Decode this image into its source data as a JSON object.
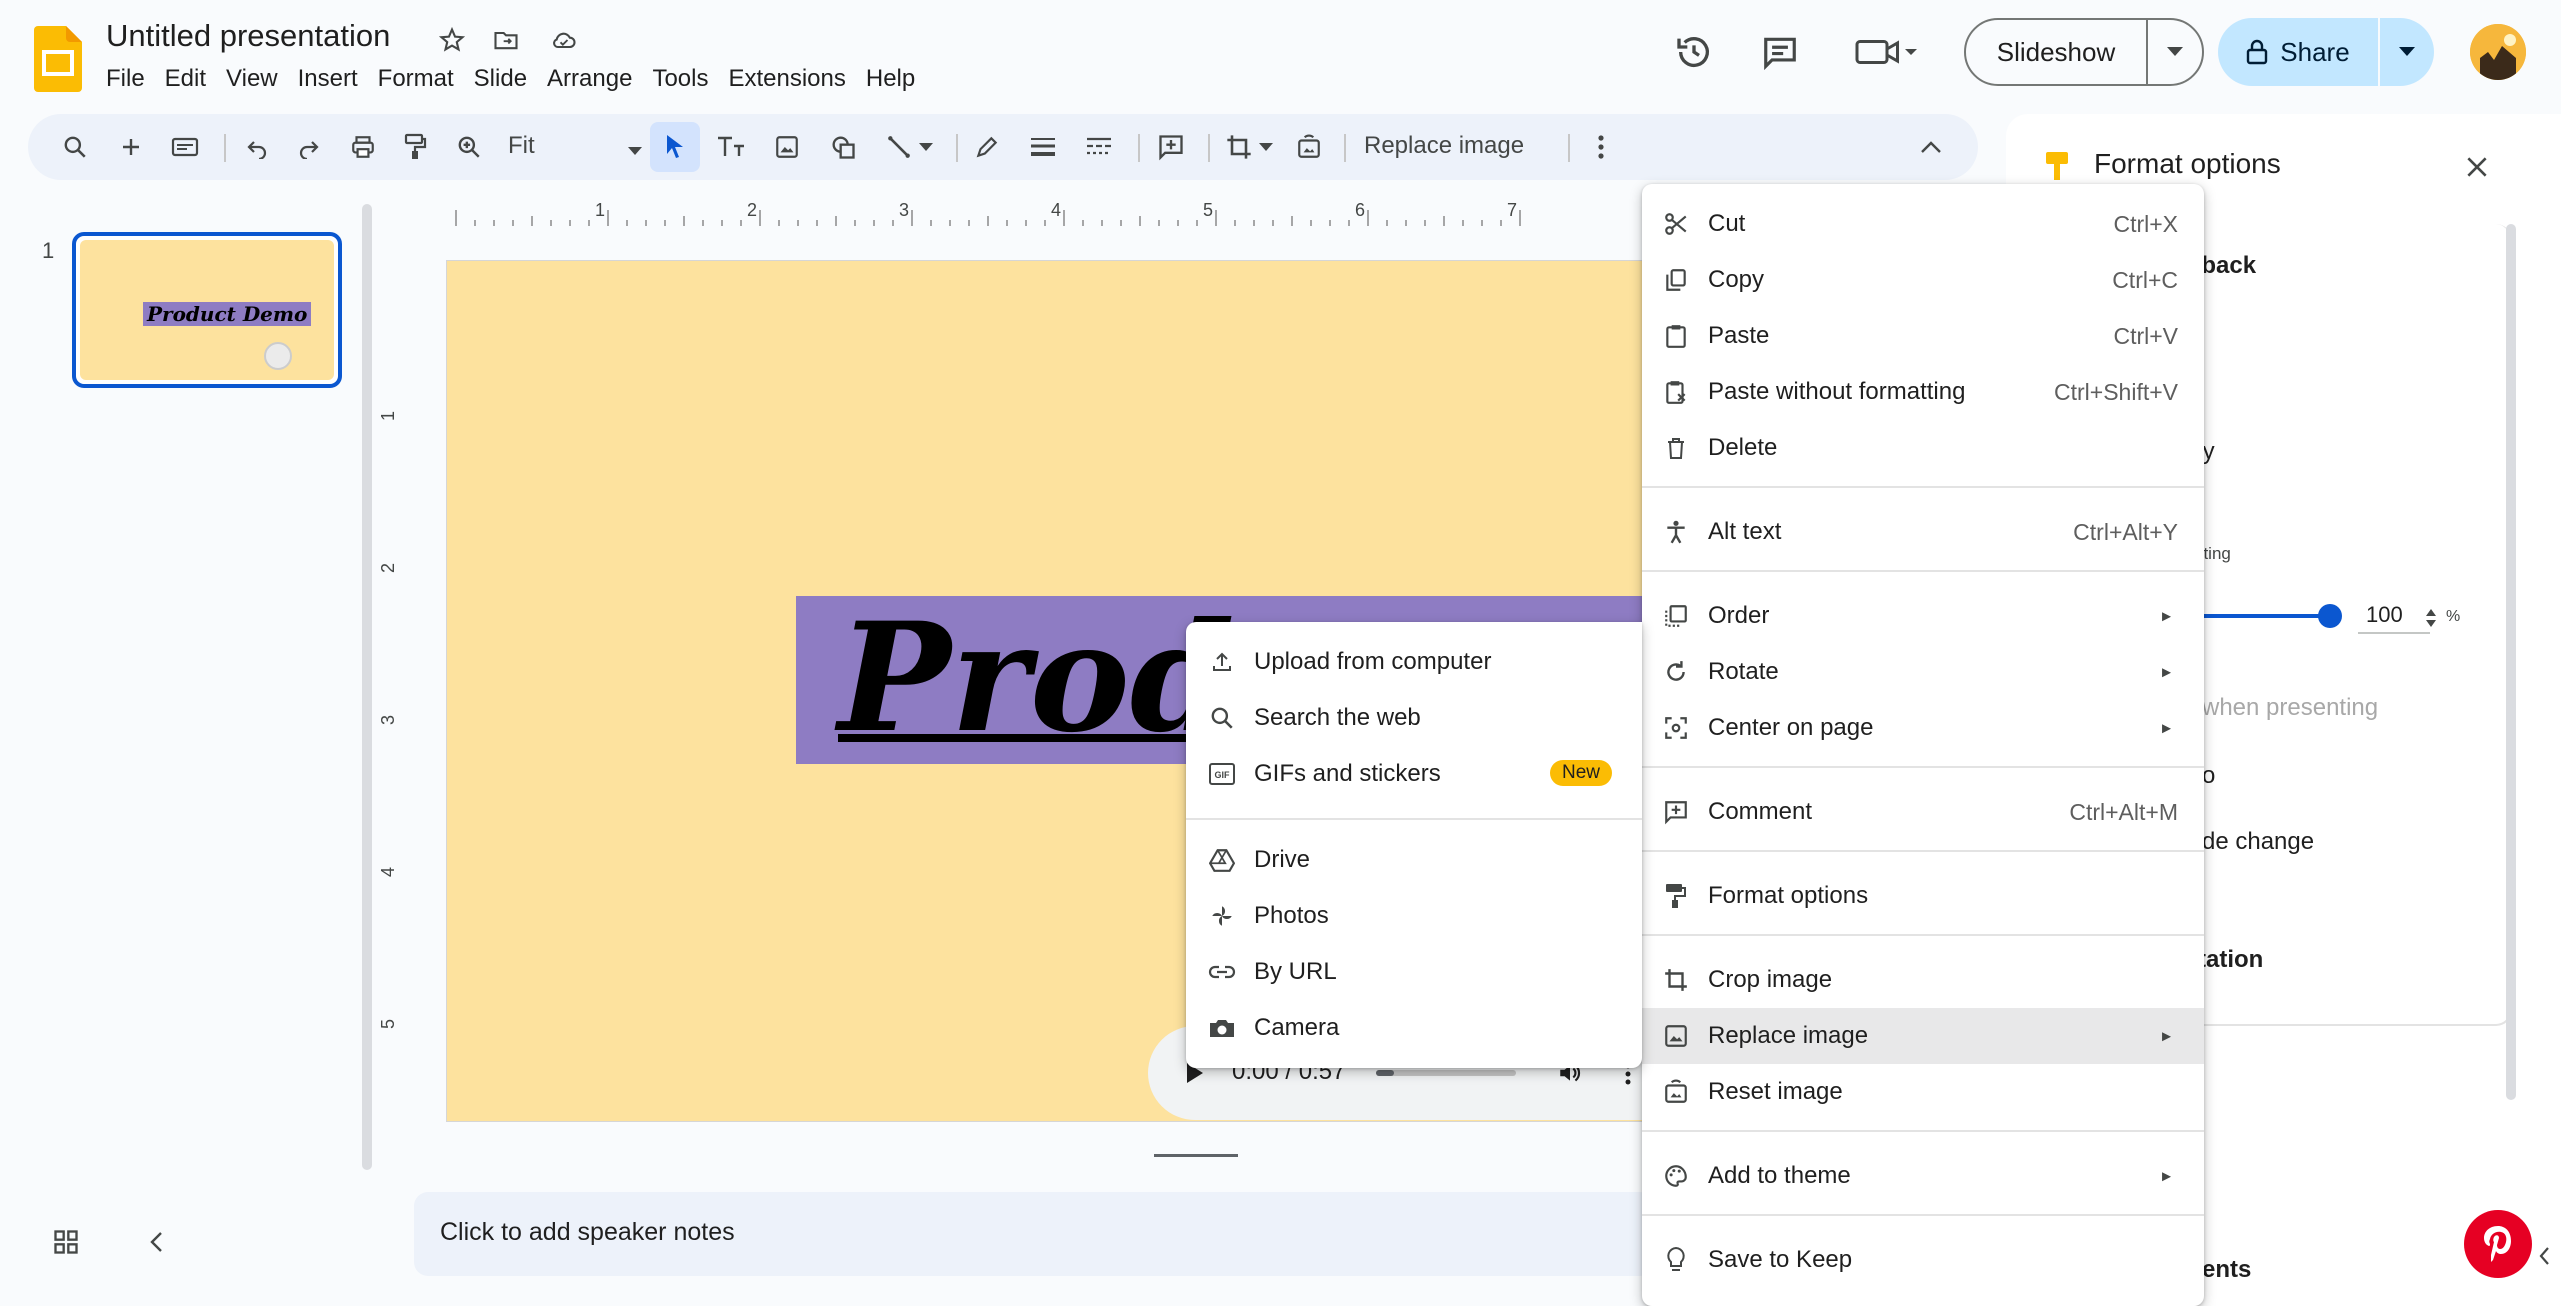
{
  "app": {
    "doc_title": "Untitled presentation",
    "menus": [
      "File",
      "Edit",
      "View",
      "Insert",
      "Format",
      "Slide",
      "Arrange",
      "Tools",
      "Extensions",
      "Help"
    ]
  },
  "header": {
    "slideshow_label": "Slideshow",
    "share_label": "Share"
  },
  "toolbar": {
    "zoom_value": "Fit",
    "replace_image_label": "Replace image"
  },
  "filmstrip": {
    "slide_number": "1",
    "thumb_title": "Product Demo"
  },
  "rulers": {
    "top": [
      "1",
      "2",
      "3",
      "4",
      "5",
      "6",
      "7"
    ],
    "left": [
      "1",
      "2",
      "3",
      "4",
      "5"
    ]
  },
  "slide": {
    "title_visible": "Produ",
    "audio_time": "0:00 / 0:57"
  },
  "notes": {
    "placeholder": "Click to add speaker notes"
  },
  "side_panel": {
    "title": "Format options",
    "fragments": [
      "yback",
      "lly",
      "nting",
      "when presenting",
      "o",
      "de change",
      "tation",
      "ents"
    ],
    "volume_value": "100",
    "volume_unit": "%"
  },
  "context_menu": {
    "groups": [
      [
        {
          "label": "Cut",
          "shortcut": "Ctrl+X",
          "icon": "scissors-icon"
        },
        {
          "label": "Copy",
          "shortcut": "Ctrl+C",
          "icon": "copy-icon"
        },
        {
          "label": "Paste",
          "shortcut": "Ctrl+V",
          "icon": "paste-icon"
        },
        {
          "label": "Paste without formatting",
          "shortcut": "Ctrl+Shift+V",
          "icon": "paste-plain-icon"
        },
        {
          "label": "Delete",
          "shortcut": "",
          "icon": "trash-icon"
        }
      ],
      [
        {
          "label": "Alt text",
          "shortcut": "Ctrl+Alt+Y",
          "icon": "accessibility-icon"
        }
      ],
      [
        {
          "label": "Order",
          "submenu": true,
          "icon": "order-icon"
        },
        {
          "label": "Rotate",
          "submenu": true,
          "icon": "rotate-icon"
        },
        {
          "label": "Center on page",
          "submenu": true,
          "icon": "center-icon"
        }
      ],
      [
        {
          "label": "Comment",
          "shortcut": "Ctrl+Alt+M",
          "icon": "comment-add-icon"
        }
      ],
      [
        {
          "label": "Format options",
          "icon": "paint-roller-icon"
        }
      ],
      [
        {
          "label": "Crop image",
          "icon": "crop-icon"
        },
        {
          "label": "Replace image",
          "submenu": true,
          "highlighted": true,
          "icon": "image-icon"
        },
        {
          "label": "Reset image",
          "icon": "reset-image-icon"
        }
      ],
      [
        {
          "label": "Add to theme",
          "submenu": true,
          "icon": "palette-icon"
        }
      ],
      [
        {
          "label": "Save to Keep",
          "icon": "lightbulb-icon"
        }
      ]
    ]
  },
  "submenu": {
    "items_top": [
      {
        "label": "Upload from computer",
        "icon": "upload-icon"
      },
      {
        "label": "Search the web",
        "icon": "search-icon"
      },
      {
        "label": "GIFs and stickers",
        "icon": "gif-icon",
        "badge": "New"
      }
    ],
    "items_bottom": [
      {
        "label": "Drive",
        "icon": "drive-icon"
      },
      {
        "label": "Photos",
        "icon": "photos-icon"
      },
      {
        "label": "By URL",
        "icon": "link-icon"
      },
      {
        "label": "Camera",
        "icon": "camera-icon"
      }
    ]
  },
  "colors": {
    "slide_bg": "#fde29e",
    "title_bg": "#8e7cc3",
    "accent": "#0b57d0",
    "share_bg": "#c2e7ff",
    "badge": "#fbbc04"
  }
}
